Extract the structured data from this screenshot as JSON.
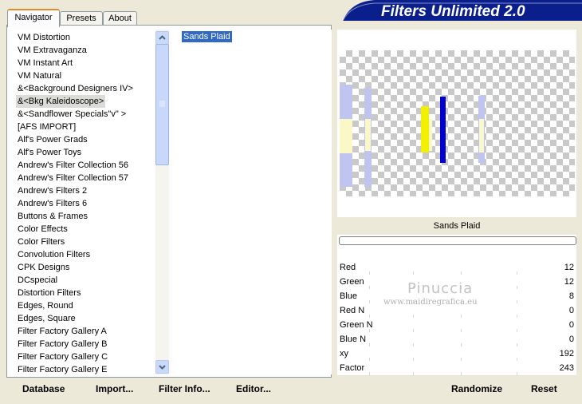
{
  "header": {
    "title": "Filters Unlimited 2.0"
  },
  "tabs": [
    {
      "label": "Navigator",
      "active": true
    },
    {
      "label": "Presets",
      "active": false
    },
    {
      "label": "About",
      "active": false
    }
  ],
  "categories": [
    "VM Distortion",
    "VM Extravaganza",
    "VM Instant Art",
    "VM Natural",
    "&<Background Designers IV>",
    "&<Bkg Kaleidoscope>",
    "&<Sandflower Specials\"v\" >",
    "[AFS IMPORT]",
    "Alf's Power Grads",
    "Alf's Power Toys",
    "Andrew's Filter Collection 56",
    "Andrew's Filter Collection 57",
    "Andrew's Filters 2",
    "Andrew's Filters 6",
    "Buttons & Frames",
    "Color Effects",
    "Color Filters",
    "Convolution Filters",
    "CPK Designs",
    "DCspecial",
    "Distortion Filters",
    "Edges, Round",
    "Edges, Square",
    "Filter Factory Gallery A",
    "Filter Factory Gallery B",
    "Filter Factory Gallery C",
    "Filter Factory Gallery E"
  ],
  "selected_category": "&<Bkg Kaleidoscope>",
  "filters": [
    "Sands Plaid"
  ],
  "selected_filter": "Sands Plaid",
  "preview_name": "Sands Plaid",
  "params": [
    {
      "label": "Red",
      "value": "12"
    },
    {
      "label": "Green",
      "value": "12"
    },
    {
      "label": "Blue",
      "value": "8"
    },
    {
      "label": "Red N",
      "value": "0"
    },
    {
      "label": "Green N",
      "value": "0"
    },
    {
      "label": "Blue N",
      "value": "0"
    },
    {
      "label": "xy",
      "value": "192"
    },
    {
      "label": "Factor",
      "value": "243"
    }
  ],
  "watermark": {
    "name": "Pinuccia",
    "url": "www.maidiregrafica.eu"
  },
  "buttons": {
    "database": "Database",
    "import": "Import...",
    "filter_info": "Filter Info...",
    "editor": "Editor...",
    "randomize": "Randomize",
    "reset": "Reset"
  },
  "colors": {
    "title_banner": "#0a1e8c",
    "selection": "#316ac5",
    "active_tab_border": "#e68b2c",
    "preview_yellow": "#f0f000",
    "preview_blue": "#0000d0",
    "preview_lavender": "#c0c4f0",
    "preview_cream": "#fbf8c8"
  },
  "icons": {
    "scroll_up": "chevron-up-icon",
    "scroll_down": "chevron-down-icon",
    "scroll_grip": "grip-icon"
  }
}
